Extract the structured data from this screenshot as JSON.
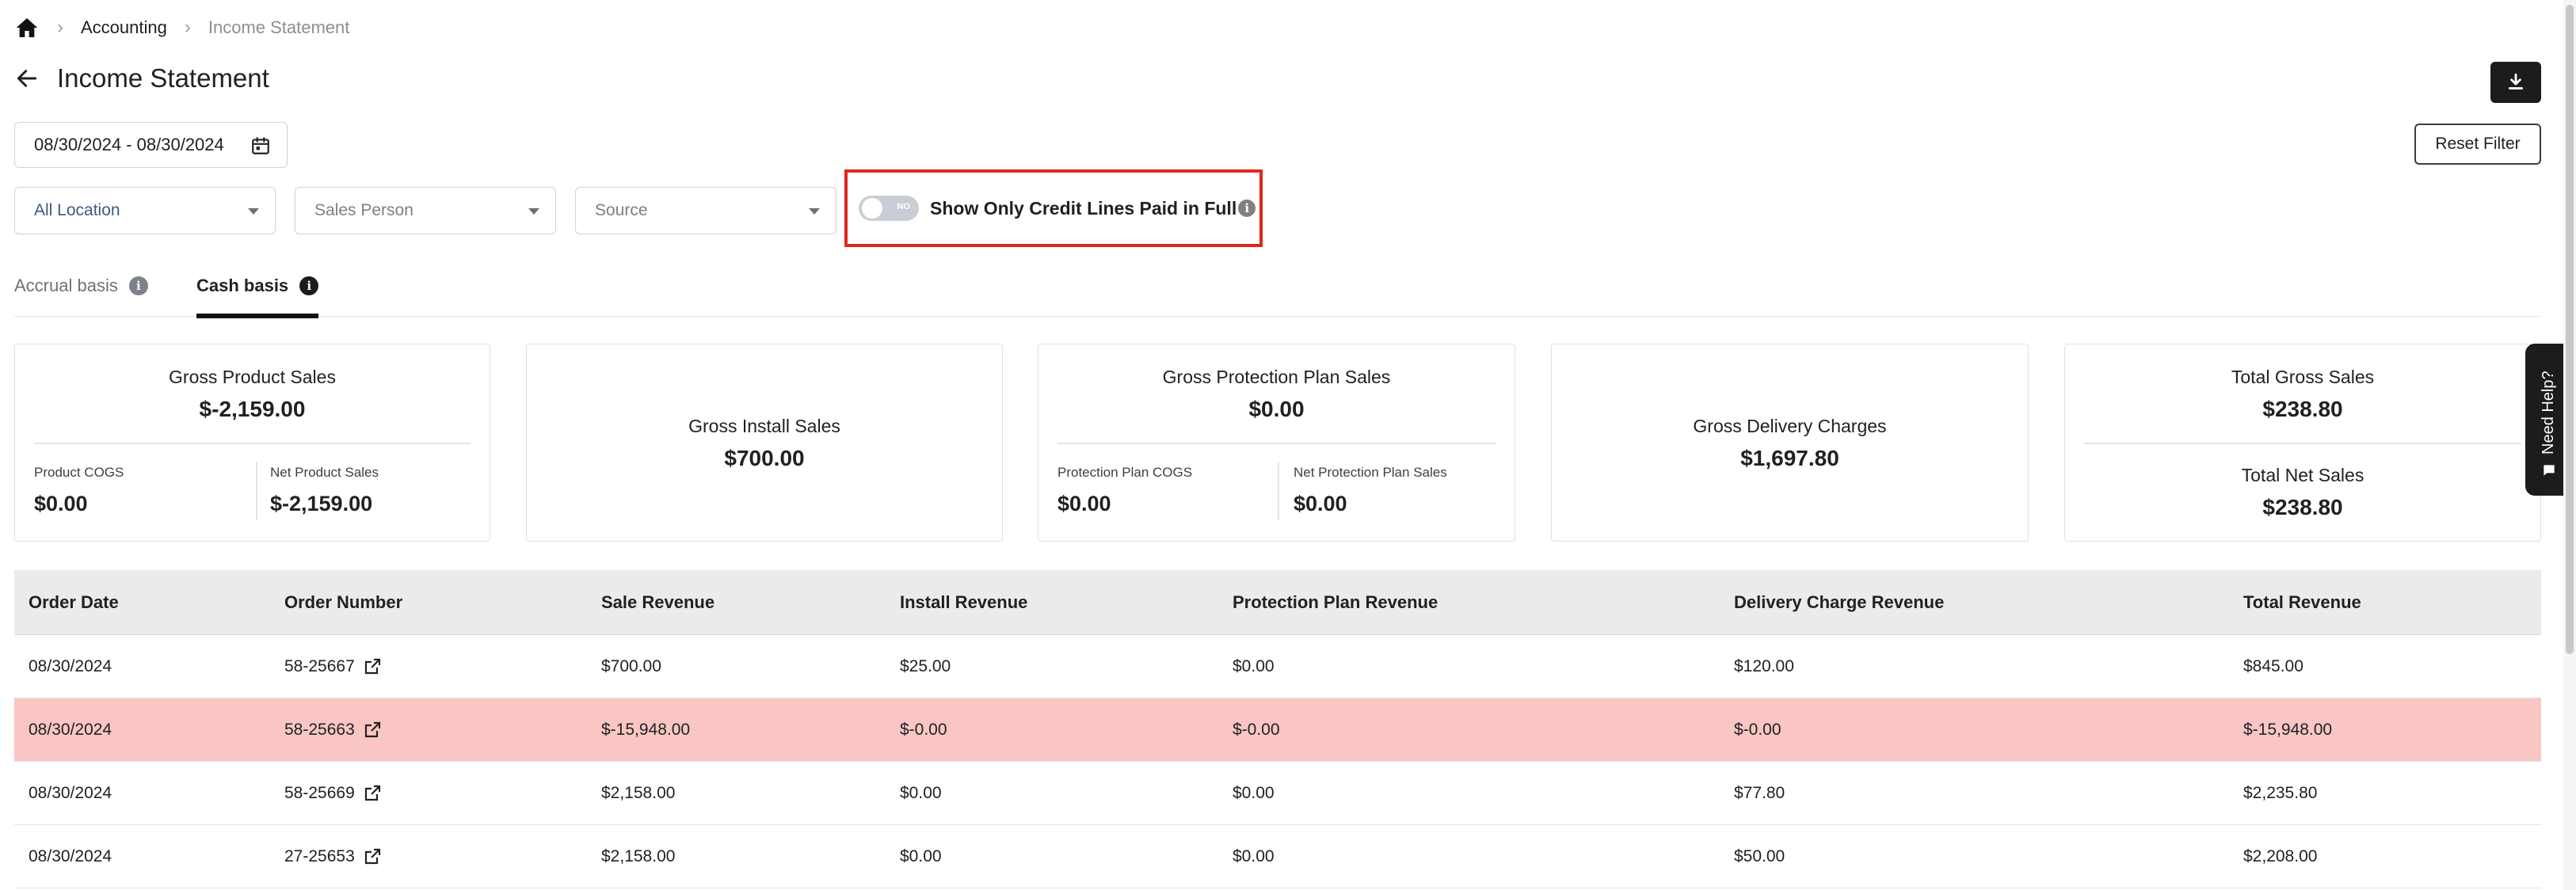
{
  "breadcrumb": {
    "items": [
      "Accounting",
      "Income Statement"
    ]
  },
  "page": {
    "title": "Income Statement"
  },
  "filters": {
    "date_range": "08/30/2024 - 08/30/2024",
    "reset_label": "Reset Filter",
    "location": "All Location",
    "sales_person": "Sales Person",
    "source": "Source",
    "toggle_state": "NO",
    "toggle_label": "Show Only Credit Lines Paid in Full"
  },
  "tabs": [
    {
      "label": "Accrual basis",
      "active": false
    },
    {
      "label": "Cash basis",
      "active": true
    }
  ],
  "cards": {
    "product": {
      "title": "Gross Product Sales",
      "value": "$-2,159.00",
      "sub1_label": "Product COGS",
      "sub1_value": "$0.00",
      "sub2_label": "Net Product Sales",
      "sub2_value": "$-2,159.00"
    },
    "install": {
      "title": "Gross Install Sales",
      "value": "$700.00"
    },
    "protection": {
      "title": "Gross Protection Plan Sales",
      "value": "$0.00",
      "sub1_label": "Protection Plan COGS",
      "sub1_value": "$0.00",
      "sub2_label": "Net Protection Plan Sales",
      "sub2_value": "$0.00"
    },
    "delivery": {
      "title": "Gross Delivery Charges",
      "value": "$1,697.80"
    },
    "total": {
      "title": "Total Gross Sales",
      "value": "$238.80",
      "title2": "Total Net Sales",
      "value2": "$238.80"
    }
  },
  "help": {
    "label": "Need Help?"
  },
  "table": {
    "headers": [
      "Order Date",
      "Order Number",
      "Sale Revenue",
      "Install Revenue",
      "Protection Plan Revenue",
      "Delivery Charge Revenue",
      "Total Revenue"
    ],
    "rows": [
      {
        "date": "08/30/2024",
        "order": "58-25667",
        "sale": "$700.00",
        "install": "$25.00",
        "protection": "$0.00",
        "delivery": "$120.00",
        "total": "$845.00"
      },
      {
        "date": "08/30/2024",
        "order": "58-25663",
        "sale": "$-15,948.00",
        "install": "$-0.00",
        "protection": "$-0.00",
        "delivery": "$-0.00",
        "total": "$-15,948.00"
      },
      {
        "date": "08/30/2024",
        "order": "58-25669",
        "sale": "$2,158.00",
        "install": "$0.00",
        "protection": "$0.00",
        "delivery": "$77.80",
        "total": "$2,235.80"
      },
      {
        "date": "08/30/2024",
        "order": "27-25653",
        "sale": "$2,158.00",
        "install": "$0.00",
        "protection": "$0.00",
        "delivery": "$50.00",
        "total": "$2,208.00"
      }
    ]
  },
  "colors": {
    "highlight_border": "#e0281a",
    "negative_row": "#f9c6c3",
    "dark": "#1c1c1c"
  }
}
